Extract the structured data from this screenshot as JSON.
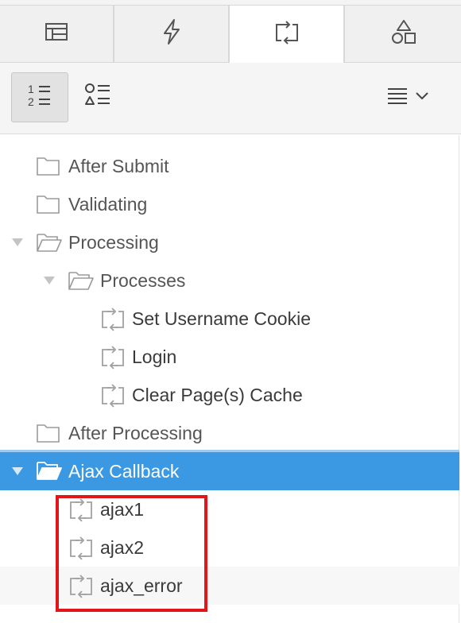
{
  "tabs": [
    {
      "name": "tab-rendering",
      "icon": "rendering-table-icon"
    },
    {
      "name": "tab-dynamic-actions",
      "icon": "lightning-icon"
    },
    {
      "name": "tab-processing",
      "icon": "process-arrows-icon"
    },
    {
      "name": "tab-shared-components",
      "icon": "shapes-icon"
    }
  ],
  "active_tab": "tab-processing",
  "toolbar": {
    "view_order_icon": "numbered-list-icon",
    "view_component_icon": "component-type-list-icon",
    "menu_icon": "menu-lines-icon",
    "menu_chevron": "chevron-down-icon"
  },
  "tree": {
    "after_submit": "After Submit",
    "validating": "Validating",
    "processing": "Processing",
    "processes": "Processes",
    "set_username_cookie": "Set Username Cookie",
    "login": "Login",
    "clear_page_cache": "Clear Page(s) Cache",
    "after_processing": "After Processing",
    "ajax_callback": "Ajax Callback",
    "ajax1": "ajax1",
    "ajax2": "ajax2",
    "ajax_error": "ajax_error"
  },
  "colors": {
    "selected_row": "#3b98e2",
    "highlight_box": "#e0161a"
  }
}
